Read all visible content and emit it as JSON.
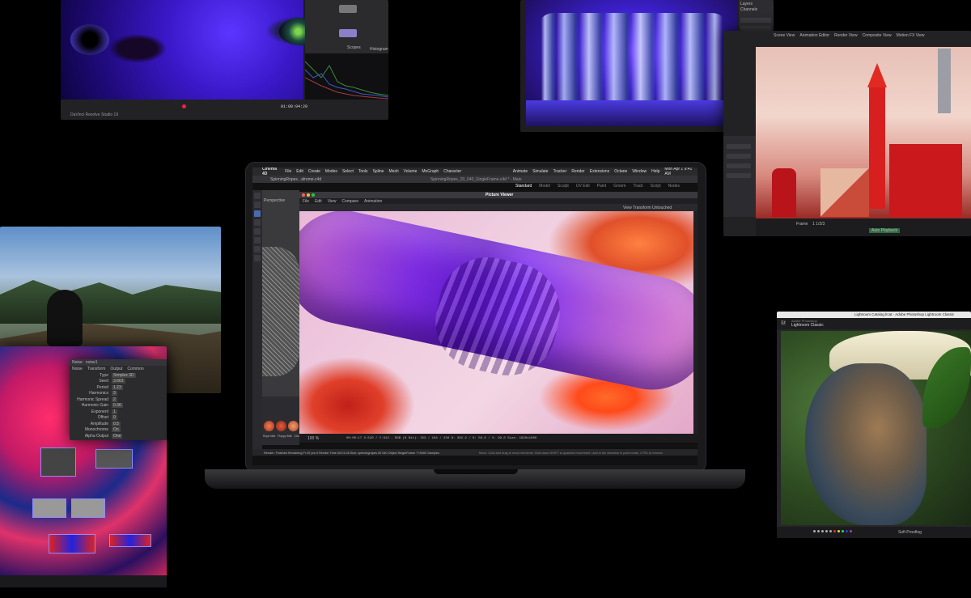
{
  "davinci": {
    "app_name": "DaVinci Resolve Studio 19",
    "timecode": "01:00:04:20",
    "node_label": "Scopes",
    "scope_label": "Histogram"
  },
  "game": {},
  "touchdesigner": {
    "tabs": [
      "Noise",
      "noise1"
    ],
    "subtabs": [
      "Noise",
      "Transform",
      "Output",
      "Common"
    ],
    "params": [
      {
        "label": "Type",
        "value": "Simplex 3D"
      },
      {
        "label": "Seed",
        "value": "3.663"
      },
      {
        "label": "Period",
        "value": "1.23"
      },
      {
        "label": "Harmonics",
        "value": "3"
      },
      {
        "label": "Harmonic Spread",
        "value": "2"
      },
      {
        "label": "Harmonic Gain",
        "value": "0.36"
      },
      {
        "label": "Exponent",
        "value": "1"
      },
      {
        "label": "Offset",
        "value": "0"
      },
      {
        "label": "Amplitude",
        "value": "0.5"
      },
      {
        "label": "Monochrome",
        "value": "On"
      },
      {
        "label": "Alpha Output",
        "value": "One"
      }
    ]
  },
  "macos": {
    "apple": "",
    "menus": [
      "Cinema 4D",
      "File",
      "Edit",
      "Create",
      "Modes",
      "Select",
      "Tools",
      "Spline",
      "Mesh",
      "Volume",
      "MoGraph",
      "Character",
      "Animate",
      "Simulate",
      "Tracker",
      "Render",
      "Extensions",
      "Octane",
      "Window",
      "Help"
    ],
    "clock": "Mon Apr 1 9:41 AM"
  },
  "cinema4d": {
    "doc_tab": "SpinningRopes...afrome.c4d",
    "doc_title": "SpinningRopes_20_040_SingleFrame.c4d * - Main",
    "layout_tabs": [
      "Standard",
      "Model",
      "Sculpt",
      "UV Edit",
      "Paint",
      "Groom",
      "Track",
      "Script",
      "Nodes"
    ],
    "viewport_label": "Perspective",
    "viewport_menus": [
      "View",
      "Cameras"
    ],
    "picture_viewer_title": "Picture Viewer",
    "pv_menus": [
      "File",
      "Edit",
      "View",
      "Compare",
      "Animation"
    ],
    "pv_transform": "View Transform  Untouched",
    "zoom": "100 %",
    "status_readout": "00:00:17   X:520 / Y:312 - RGB (8 Bit): 253 / 104 / 230   H: 302.2 / S: 58.0 / V: 99.0   Size: 1920x1080",
    "status_line": "Render: Finished Rendering  Fr 00 pro 0 Render Time 00:01:28  Size: spinningropes 00 040  Object SingleFrame 7+5000 Samples",
    "status_hint": "Move: Click and drag to move elements. Hold down SHIFT to quantize movement / add to the selection in point mode, CTRL to remove.",
    "material_labels": [
      "Rope Mat",
      "Floppy Mat",
      "Cloud"
    ]
  },
  "photoshop_top": {
    "panel_tabs": [
      "Layers",
      "Channels"
    ]
  },
  "houdini": {
    "tabs": [
      "Scene View",
      "Animation Editor",
      "Render View",
      "Composite View",
      "Motion FX View"
    ],
    "frame_label": "Frame",
    "frame_value": "1 1/2/3",
    "button_label": "Auto Playback"
  },
  "lightroom": {
    "window_title": "Lightroom Catalog.lrcat - Adobe Photoshop Lightroom Classic",
    "brand": "Adobe Photoshop",
    "app": "Lightroom Classic",
    "filmstrip_label": "Soft Proofing"
  },
  "colors": {
    "bg": "#000000",
    "accent": "#f2c12e"
  }
}
